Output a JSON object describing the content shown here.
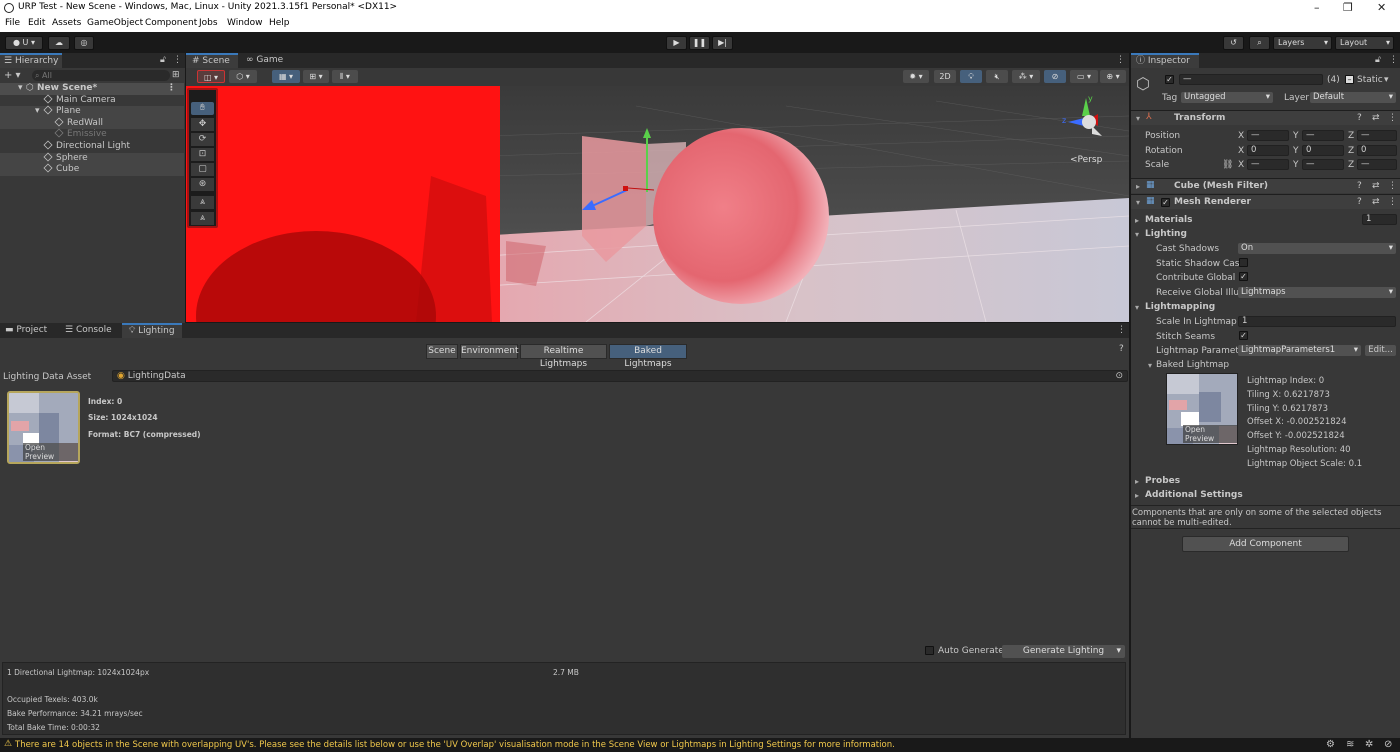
{
  "window": {
    "title": "URP Test - New Scene - Windows, Mac, Linux - Unity 2021.3.15f1 Personal* <DX11>",
    "minimize": "–",
    "maximize": "❐",
    "close": "✕"
  },
  "menu": [
    "File",
    "Edit",
    "Assets",
    "GameObject",
    "Component",
    "Jobs",
    "Window",
    "Help"
  ],
  "toolbar": {
    "account_label": "U ▾",
    "layers_label": "Layers",
    "layout_label": "Layout"
  },
  "hierarchy": {
    "tab_label": "Hierarchy",
    "search_placeholder": "All",
    "add_label": "+ ▾",
    "items": [
      {
        "label": "New Scene*"
      },
      {
        "label": "Main Camera"
      },
      {
        "label": "Plane"
      },
      {
        "label": "RedWall"
      },
      {
        "label": "Emissive"
      },
      {
        "label": "Directional Light"
      },
      {
        "label": "Sphere"
      },
      {
        "label": "Cube"
      }
    ]
  },
  "scene": {
    "tabs": [
      {
        "label": "Scene"
      },
      {
        "label": "Game"
      }
    ],
    "mode_2d": "2D",
    "persp_label": "<Persp",
    "gizmo_y": "y",
    "gizmo_z": "z"
  },
  "bottom": {
    "tabs": [
      {
        "label": "Project"
      },
      {
        "label": "Console"
      },
      {
        "label": "Lighting"
      }
    ],
    "lighting_tabs": [
      {
        "label": "Scene"
      },
      {
        "label": "Environment"
      },
      {
        "label": "Realtime Lightmaps"
      },
      {
        "label": "Baked Lightmaps"
      }
    ],
    "asset_label": "Lighting Data Asset",
    "asset_value": "LightingData",
    "lightmap": {
      "index": "Index: 0",
      "size": "Size: 1024x1024",
      "format": "Format: BC7 (compressed)",
      "open_preview": "Open Preview"
    },
    "auto_generate": "Auto Generate",
    "generate_lighting": "Generate Lighting",
    "stats": {
      "directional": "1 Directional Lightmap: 1024x1024px",
      "size": "2.7 MB",
      "occupied": "Occupied Texels: 403.0k",
      "performance": "Bake Performance: 34.21 mrays/sec",
      "bake_time": "Total Bake Time: 0:00:32"
    }
  },
  "inspector": {
    "tab_label": "Inspector",
    "name_value": "—",
    "count_label": "(4)",
    "static_label": "Static",
    "tag_label": "Tag",
    "tag_value": "Untagged",
    "layer_label": "Layer",
    "layer_value": "Default",
    "transform": {
      "title": "Transform",
      "position_label": "Position",
      "rotation_label": "Rotation",
      "scale_label": "Scale",
      "axis_x": "X",
      "axis_y": "Y",
      "axis_z": "Z",
      "position": [
        "—",
        "—",
        "—"
      ],
      "rotation": [
        "0",
        "0",
        "0"
      ],
      "scale": [
        "—",
        "—",
        "—"
      ]
    },
    "mesh_filter_title": "Cube (Mesh Filter)",
    "mesh_renderer_title": "Mesh Renderer",
    "materials_label": "Materials",
    "materials_value": "1",
    "lighting_label": "Lighting",
    "cast_shadows_label": "Cast Shadows",
    "cast_shadows_value": "On",
    "static_shadow_label": "Static Shadow Cast",
    "contribute_gi_label": "Contribute Global Ill",
    "receive_gi_label": "Receive Global Illun",
    "receive_gi_value": "Lightmaps",
    "lightmapping_label": "Lightmapping",
    "scale_lightmap_label": "Scale In Lightmap",
    "scale_lightmap_value": "1",
    "stitch_seams_label": "Stitch Seams",
    "lightmap_params_label": "Lightmap Paramete",
    "lightmap_params_value": "LightmapParameters1",
    "edit_label": "Edit...",
    "baked_lightmap_label": "Baked Lightmap",
    "baked_info": [
      "Lightmap Index: 0",
      "Tiling X: 0.6217873",
      "Tiling Y: 0.6217873",
      "Offset X: -0.002521824",
      "Offset Y: -0.002521824",
      "Lightmap Resolution: 40",
      "Lightmap Object Scale: 0.1"
    ],
    "open_preview": "Open Preview",
    "probes_label": "Probes",
    "additional_label": "Additional Settings",
    "multi_edit_note": "Components that are only on some of the selected objects cannot be multi-edited.",
    "add_component": "Add Component"
  },
  "status": {
    "warning": "There are 14 objects in the Scene with overlapping UV's. Please see the details list below or use the 'UV Overlap' visualisation mode in the Scene View or Lightmaps in Lighting Settings for more information."
  },
  "colors": {
    "accent": "#3a79bb",
    "selected_tab": "#46607c",
    "warning": "#f2c94c",
    "red_wall": "#ff1212"
  }
}
